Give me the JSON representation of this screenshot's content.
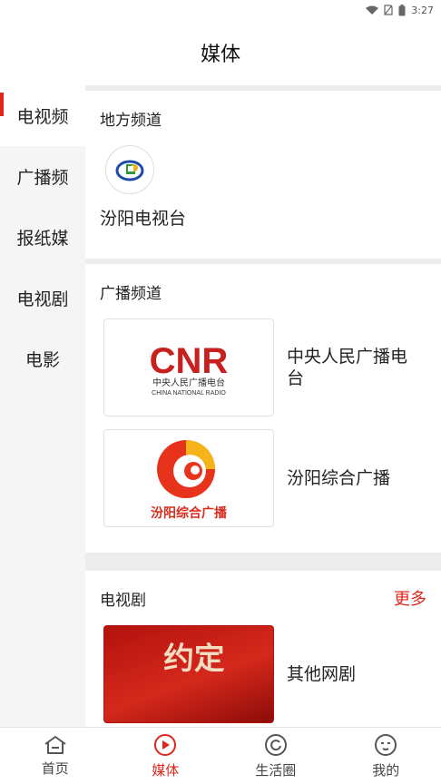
{
  "status": {
    "time": "3:27"
  },
  "header": {
    "title": "媒体"
  },
  "sidebar": {
    "items": [
      {
        "label": "电视频",
        "active": true
      },
      {
        "label": "广播频",
        "active": false
      },
      {
        "label": "报纸媒",
        "active": false
      },
      {
        "label": "电视剧",
        "active": false
      },
      {
        "label": "电影",
        "active": false
      }
    ]
  },
  "sections": {
    "local": {
      "title": "地方频道",
      "channel_name": "汾阳电视台"
    },
    "radio": {
      "title": "广播频道",
      "items": [
        {
          "name": "中央人民广播电台",
          "logo_text": "CNR",
          "logo_sub": "中央人民广播电台",
          "logo_en": "CHINA NATIONAL RADIO"
        },
        {
          "name": "汾阳综合广播",
          "logo_text": "汾阳综合广播"
        }
      ]
    },
    "drama": {
      "title": "电视剧",
      "more": "更多",
      "items": [
        {
          "name": "其他网剧",
          "poster_text": "约定"
        }
      ]
    }
  },
  "tabbar": {
    "tabs": [
      {
        "label": "首页",
        "icon": "home-icon",
        "active": false
      },
      {
        "label": "媒体",
        "icon": "media-play-icon",
        "active": true
      },
      {
        "label": "生活圈",
        "icon": "life-circle-icon",
        "active": false
      },
      {
        "label": "我的",
        "icon": "profile-icon",
        "active": false
      }
    ]
  },
  "colors": {
    "accent": "#e0251d",
    "cnr_red": "#c8201e"
  }
}
